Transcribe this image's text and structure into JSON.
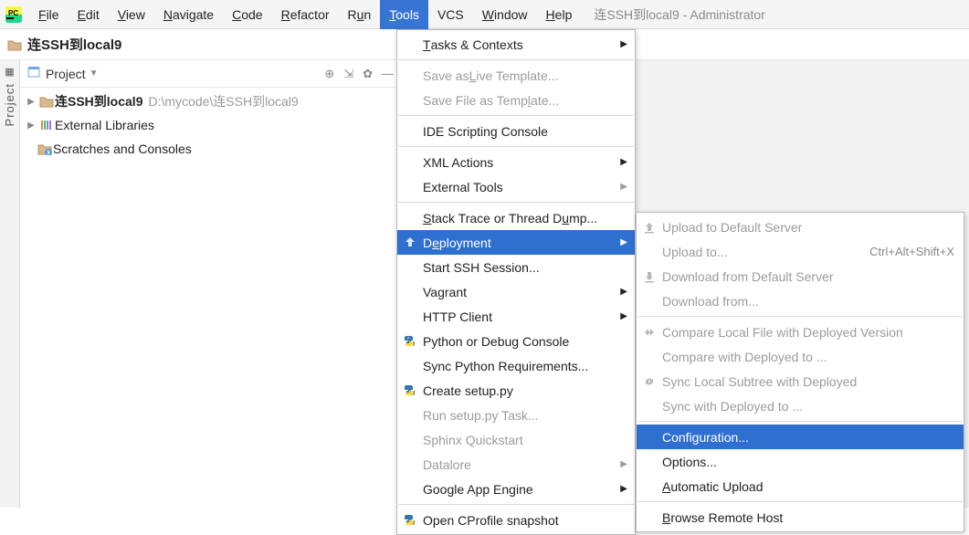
{
  "window": {
    "title": "连SSH到local9 - Administrator"
  },
  "menubar": {
    "file": "File",
    "edit": "Edit",
    "view": "View",
    "navigate": "Navigate",
    "code": "Code",
    "refactor": "Refactor",
    "run": "Run",
    "tools": "Tools",
    "vcs": "VCS",
    "window": "Window",
    "help": "Help"
  },
  "breadcrumb": {
    "project": "连SSH到local9"
  },
  "sidebar": {
    "project_tab": "Project"
  },
  "project_panel": {
    "header": "Project",
    "root": {
      "name": "连SSH到local9",
      "path": "D:\\mycode\\连SSH到local9"
    },
    "external_libraries": "External Libraries",
    "scratches": "Scratches and Consoles"
  },
  "tools_menu": {
    "tasks_contexts": "Tasks & Contexts",
    "save_live_template": "Save as Live Template...",
    "save_file_template": "Save File as Template...",
    "ide_scripting": "IDE Scripting Console",
    "xml_actions": "XML Actions",
    "external_tools": "External Tools",
    "stack_trace": "Stack Trace or Thread Dump...",
    "deployment": "Deployment",
    "start_ssh": "Start SSH Session...",
    "vagrant": "Vagrant",
    "http_client": "HTTP Client",
    "python_console": "Python or Debug Console",
    "sync_python_req": "Sync Python Requirements...",
    "create_setup": "Create setup.py",
    "run_setup": "Run setup.py Task...",
    "sphinx": "Sphinx Quickstart",
    "datalore": "Datalore",
    "gae": "Google App Engine",
    "cprofile": "Open CProfile snapshot"
  },
  "deploy_menu": {
    "upload_default": "Upload to Default Server",
    "upload_to": "Upload to...",
    "upload_to_shortcut": "Ctrl+Alt+Shift+X",
    "download_default": "Download from Default Server",
    "download_from": "Download from...",
    "compare_local": "Compare Local File with Deployed Version",
    "compare_deployed": "Compare with Deployed to ...",
    "sync_local_subtree": "Sync Local Subtree with Deployed",
    "sync_deployed": "Sync with Deployed to ...",
    "configuration": "Configuration...",
    "options": "Options...",
    "automatic_upload": "Automatic Upload",
    "browse_remote": "Browse Remote Host"
  }
}
